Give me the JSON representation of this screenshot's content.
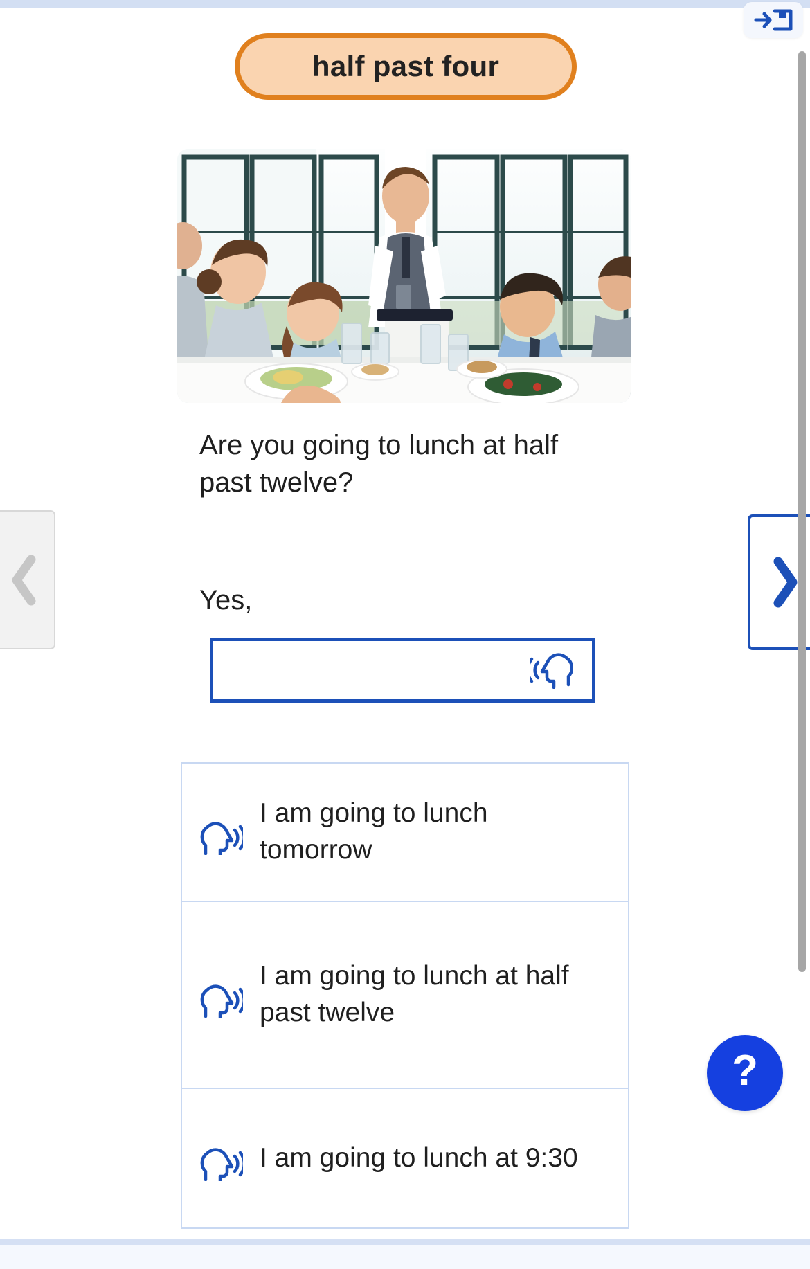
{
  "header": {
    "prompt_pill_text": "half past four",
    "exit_button_name": "exit-to-menu-icon",
    "pill_fill_color": "#fad4b0",
    "pill_border_color": "#e0801e"
  },
  "scene": {
    "alt": "Waiter serving drinks to a group of people at a restaurant lunch table",
    "icon": "restaurant-lunch-photo"
  },
  "exercise": {
    "question": "Are you going to lunch at half past twelve?",
    "answer_stem": "Yes,",
    "answer_input": {
      "value": "",
      "placeholder": "",
      "icon": "speak-microphone-icon"
    }
  },
  "options": [
    {
      "label": "I am going to lunch tomorrow",
      "icon": "speaker-head-icon"
    },
    {
      "label": "I am going to lunch at half past twelve",
      "icon": "speaker-head-icon"
    },
    {
      "label": "I am going to lunch at 9:30",
      "icon": "speaker-head-icon"
    }
  ],
  "navigation": {
    "prev_label": "‹",
    "prev_icon": "chevron-left-icon",
    "prev_enabled": false,
    "next_label": "›",
    "next_icon": "chevron-right-icon",
    "next_enabled": true
  },
  "help": {
    "label": "?",
    "icon": "question-mark-icon",
    "color": "#1540e0"
  },
  "scrollbar": {
    "orientation": "vertical",
    "thumb_color": "#a6a6a6"
  },
  "colors": {
    "accent_blue": "#1c50b8",
    "accent_orange": "#e0801e",
    "option_border": "#c8d8f2",
    "chrome_bar": "#d3dff3"
  }
}
